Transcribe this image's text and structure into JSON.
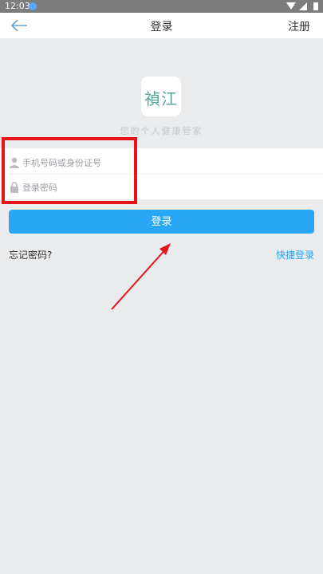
{
  "status_bar": {
    "time": "12:03"
  },
  "nav": {
    "title": "登录",
    "register_label": "注册"
  },
  "logo": {
    "text": "禎江",
    "slogan": "您的个人健康管家"
  },
  "form": {
    "phone_placeholder": "手机号码或身份证号",
    "phone_value": "",
    "password_placeholder": "登录密码",
    "password_value": ""
  },
  "actions": {
    "login_label": "登录",
    "forgot_label": "忘记密码?",
    "quick_login_label": "快捷登录"
  },
  "colors": {
    "accent": "#29a7f4",
    "link": "#2aa4f0",
    "annotation": "#e8141b",
    "background": "#e9ebed",
    "logo_teal": "#5aa59b"
  },
  "icons": [
    "back-arrow-icon",
    "user-icon",
    "lock-icon",
    "wifi-icon",
    "signal-icon",
    "battery-icon"
  ]
}
